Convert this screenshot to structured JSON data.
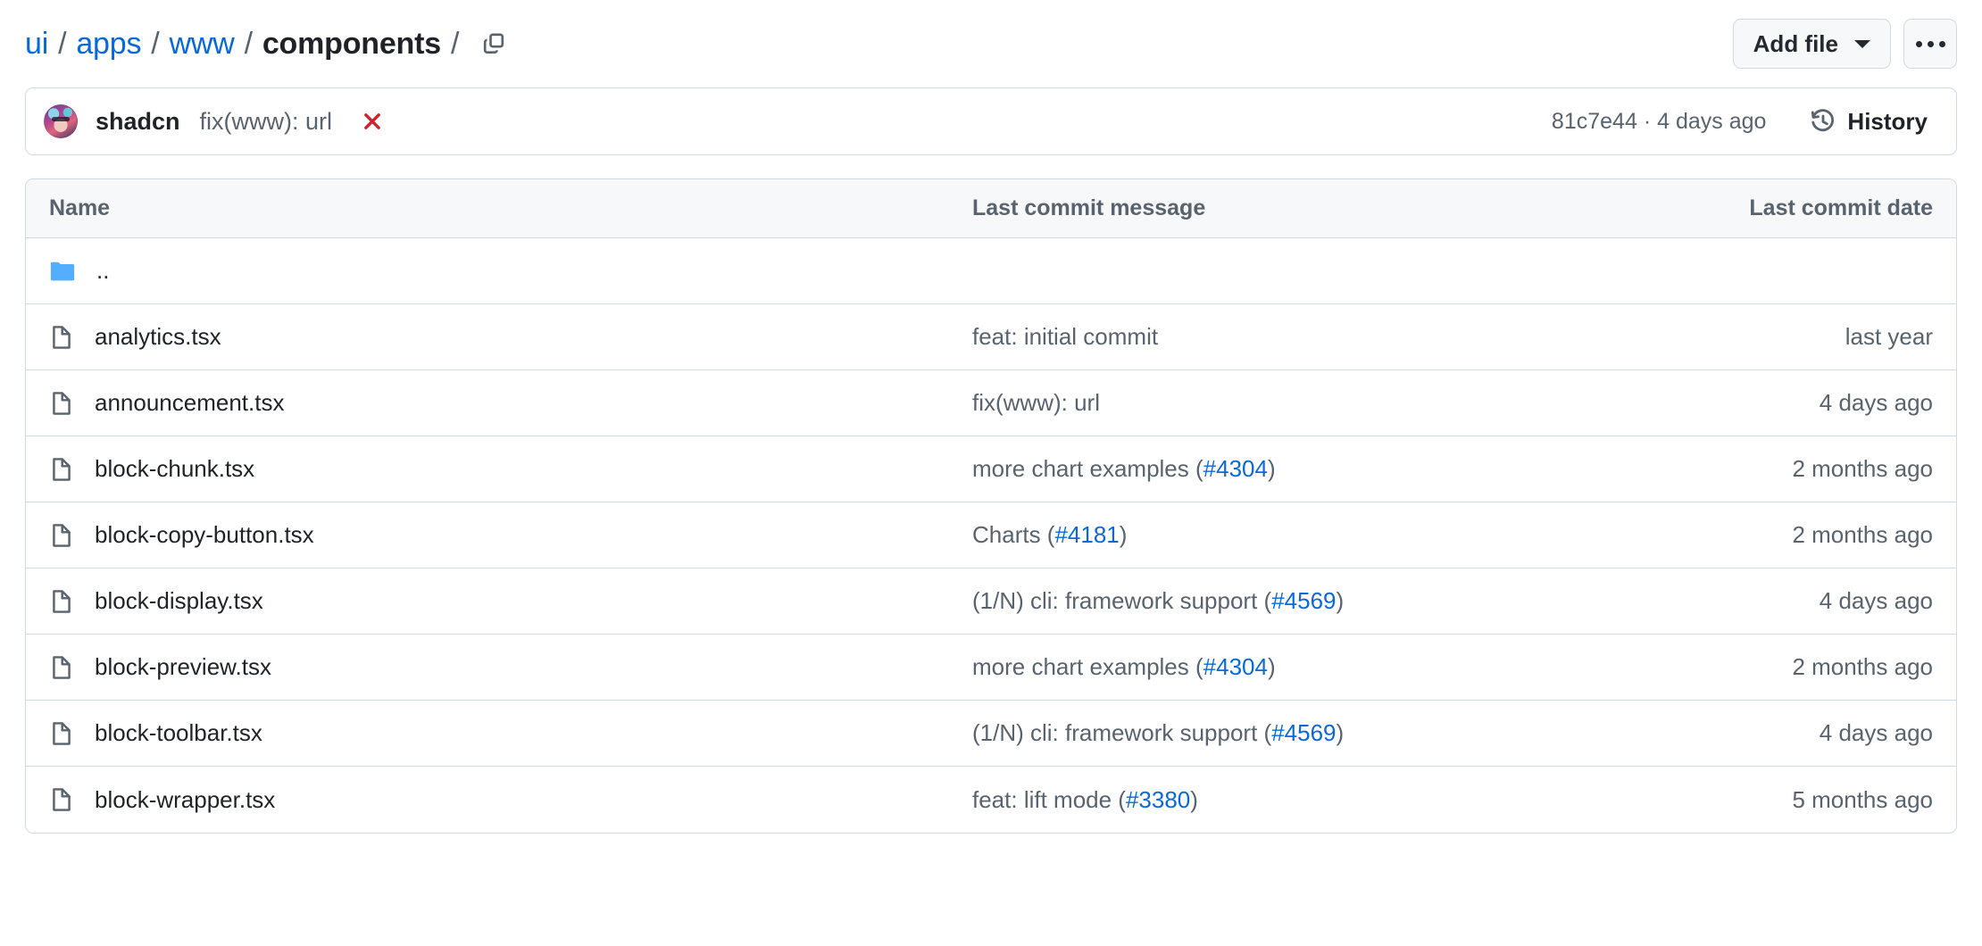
{
  "breadcrumb": {
    "separator": "/",
    "segments": [
      {
        "label": "ui",
        "current": false
      },
      {
        "label": "apps",
        "current": false
      },
      {
        "label": "www",
        "current": false
      },
      {
        "label": "components",
        "current": true
      }
    ],
    "copy_path_icon": "copy-icon"
  },
  "top_actions": {
    "add_file_label": "Add file",
    "add_file_caret_icon": "chevron-down-icon",
    "kebab_icon": "kebab-horizontal-icon"
  },
  "latest_commit": {
    "avatar_alt": "shadcn",
    "author": "shadcn",
    "message": "fix(www): url",
    "status_icon": "x-icon",
    "status_color": "#cf222e",
    "sha": "81c7e44",
    "separator": "·",
    "relative_time": "4 days ago",
    "history_icon": "history-icon",
    "history_label": "History"
  },
  "table": {
    "columns": {
      "name": "Name",
      "message": "Last commit message",
      "date": "Last commit date"
    },
    "rows": [
      {
        "icon": "folder-icon",
        "kind": "directory",
        "name": "..",
        "message_prefix": "",
        "pr": "",
        "message_suffix": "",
        "date": ""
      },
      {
        "icon": "file-icon",
        "kind": "file",
        "name": "analytics.tsx",
        "message_prefix": "feat: initial commit",
        "pr": "",
        "message_suffix": "",
        "date": "last year"
      },
      {
        "icon": "file-icon",
        "kind": "file",
        "name": "announcement.tsx",
        "message_prefix": "fix(www): url",
        "pr": "",
        "message_suffix": "",
        "date": "4 days ago"
      },
      {
        "icon": "file-icon",
        "kind": "file",
        "name": "block-chunk.tsx",
        "message_prefix": "more chart examples (",
        "pr": "#4304",
        "message_suffix": ")",
        "date": "2 months ago"
      },
      {
        "icon": "file-icon",
        "kind": "file",
        "name": "block-copy-button.tsx",
        "message_prefix": "Charts (",
        "pr": "#4181",
        "message_suffix": ")",
        "date": "2 months ago"
      },
      {
        "icon": "file-icon",
        "kind": "file",
        "name": "block-display.tsx",
        "message_prefix": "(1/N) cli: framework support (",
        "pr": "#4569",
        "message_suffix": ")",
        "date": "4 days ago"
      },
      {
        "icon": "file-icon",
        "kind": "file",
        "name": "block-preview.tsx",
        "message_prefix": "more chart examples (",
        "pr": "#4304",
        "message_suffix": ")",
        "date": "2 months ago"
      },
      {
        "icon": "file-icon",
        "kind": "file",
        "name": "block-toolbar.tsx",
        "message_prefix": "(1/N) cli: framework support (",
        "pr": "#4569",
        "message_suffix": ")",
        "date": "4 days ago"
      },
      {
        "icon": "file-icon",
        "kind": "file",
        "name": "block-wrapper.tsx",
        "message_prefix": "feat: lift mode (",
        "pr": "#3380",
        "message_suffix": ")",
        "date": "5 months ago"
      }
    ]
  },
  "colors": {
    "link": "#0969da",
    "text": "#1f2328",
    "muted": "#59636e",
    "border": "#d1d9e0",
    "header_bg": "#f6f8fa",
    "folder": "#54aeff",
    "danger": "#cf222e"
  }
}
